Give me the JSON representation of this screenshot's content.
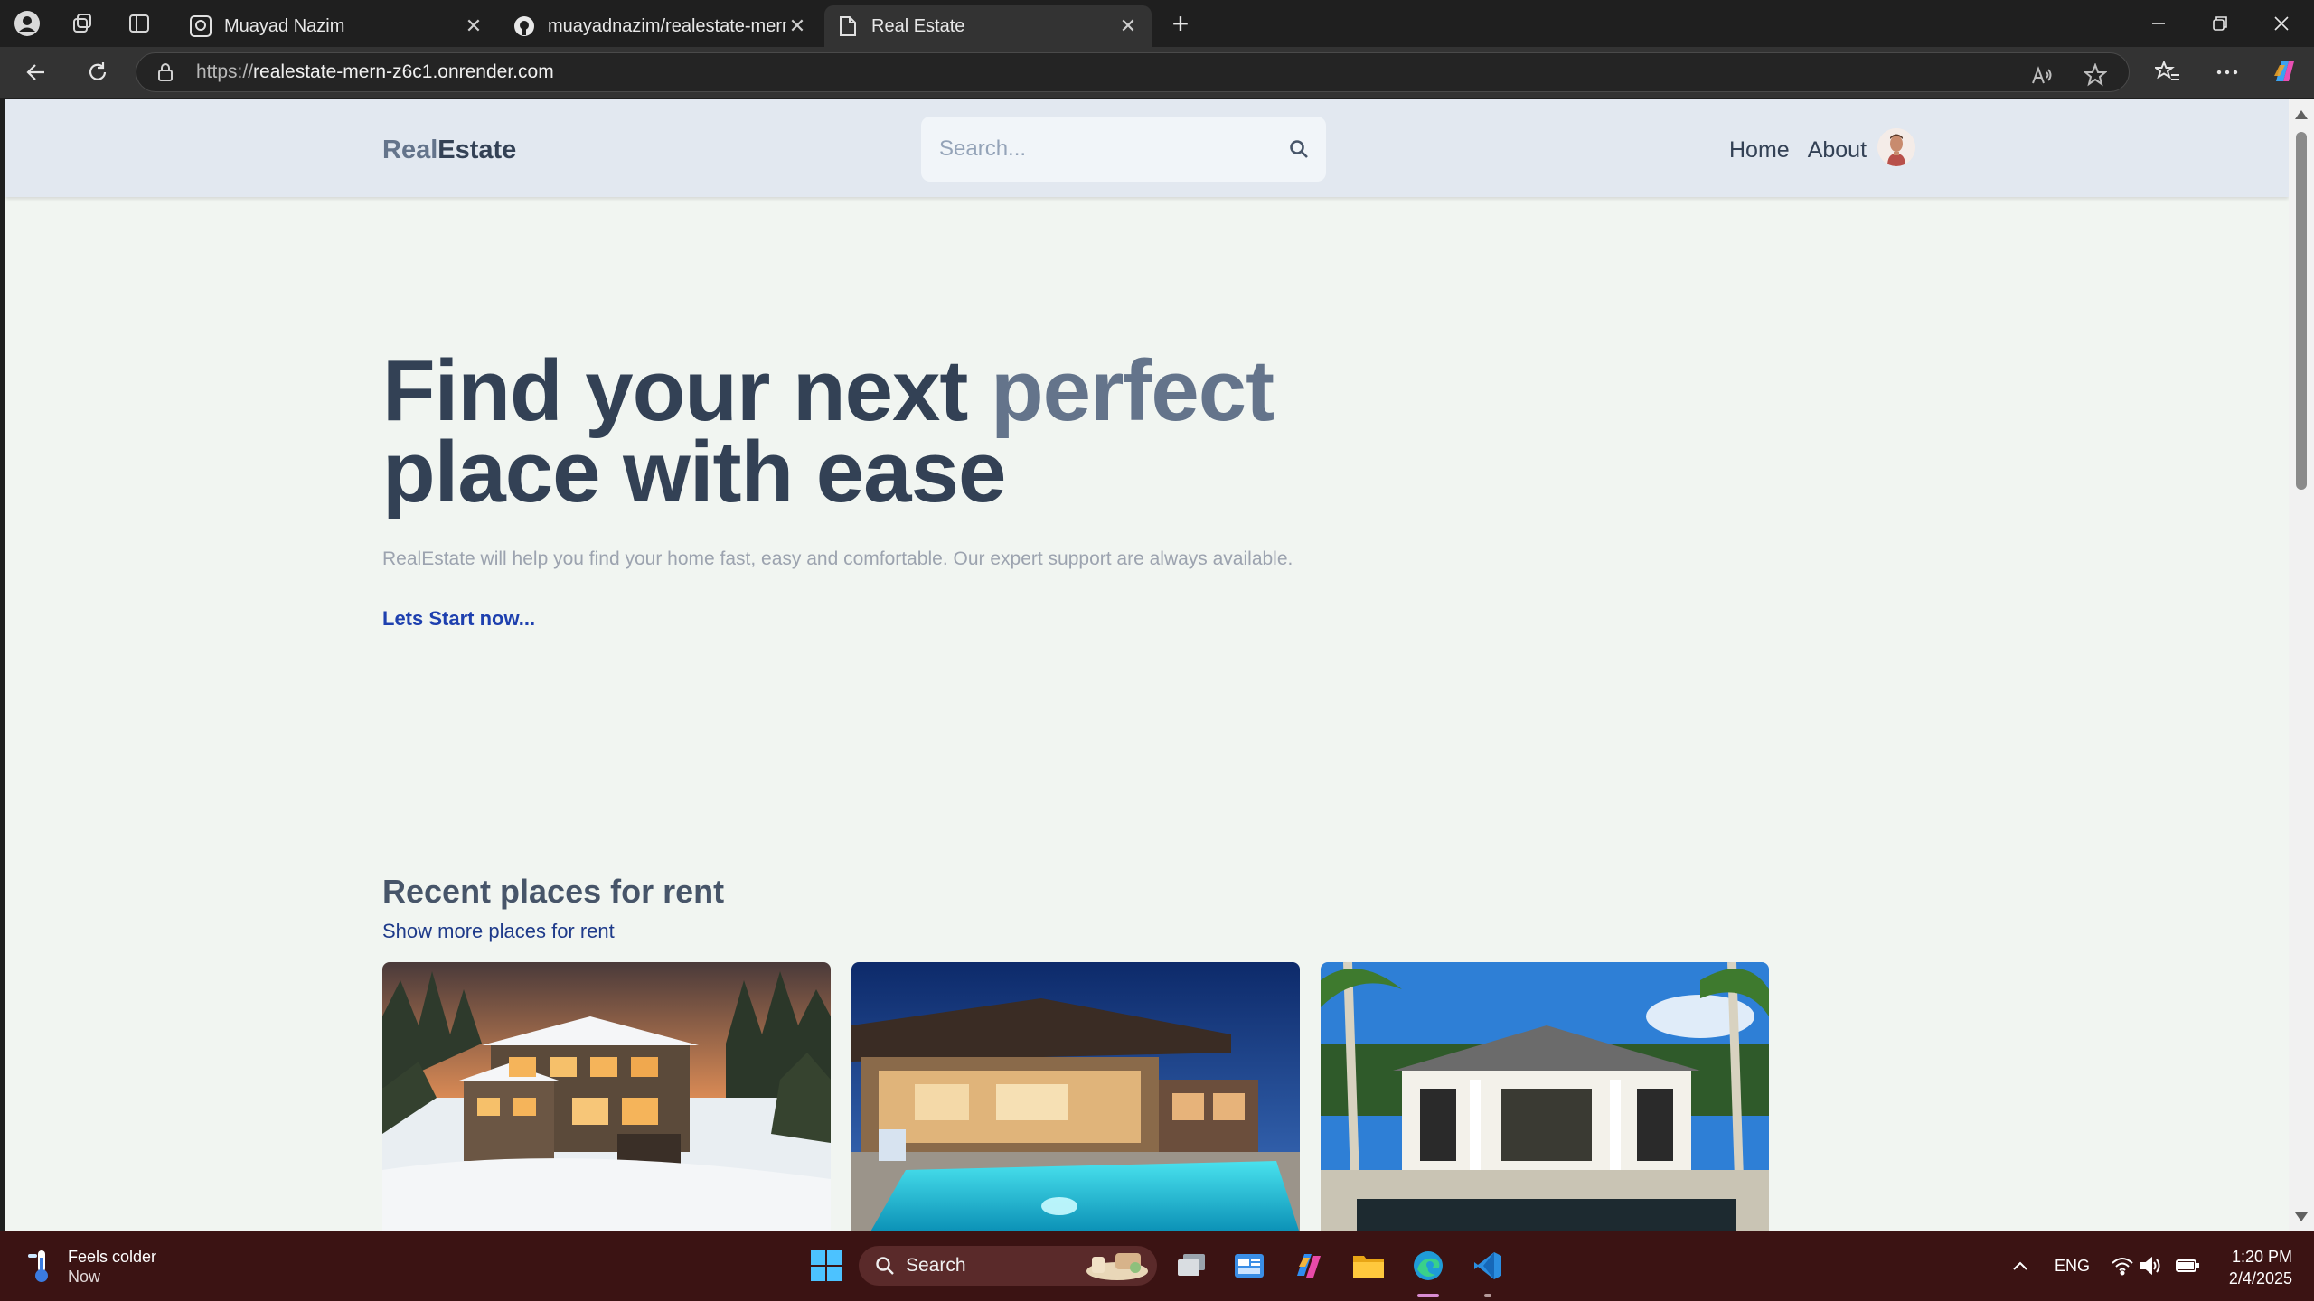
{
  "browser": {
    "tabs": [
      {
        "title": "Muayad Nazim",
        "active": false
      },
      {
        "title": "muayadnazim/realestate-mern: re",
        "active": false
      },
      {
        "title": "Real Estate",
        "active": true
      }
    ],
    "url_host": "https://",
    "url_domain": "realestate-mern-z6c1.onrender.com"
  },
  "site": {
    "logo_part1": "Real",
    "logo_part2": "Estate",
    "search_placeholder": "Search...",
    "nav": {
      "home": "Home",
      "about": "About"
    }
  },
  "hero": {
    "title_part1": "Find your next ",
    "title_accent": "perfect",
    "title_part2": "place with ease",
    "subtitle": "RealEstate will help you find your home fast, easy and comfortable. Our expert support are always available.",
    "cta": "Lets Start now..."
  },
  "recent": {
    "title": "Recent places for rent",
    "link": "Show more places for rent",
    "cards": [
      {
        "image": "snowy-mountain-house"
      },
      {
        "image": "pool-house-night"
      },
      {
        "image": "tropical-villa"
      }
    ]
  },
  "taskbar": {
    "weather_line1": "Feels colder",
    "weather_line2": "Now",
    "search_label": "Search",
    "lang": "ENG",
    "time": "1:20 PM",
    "date": "2/4/2025"
  }
}
